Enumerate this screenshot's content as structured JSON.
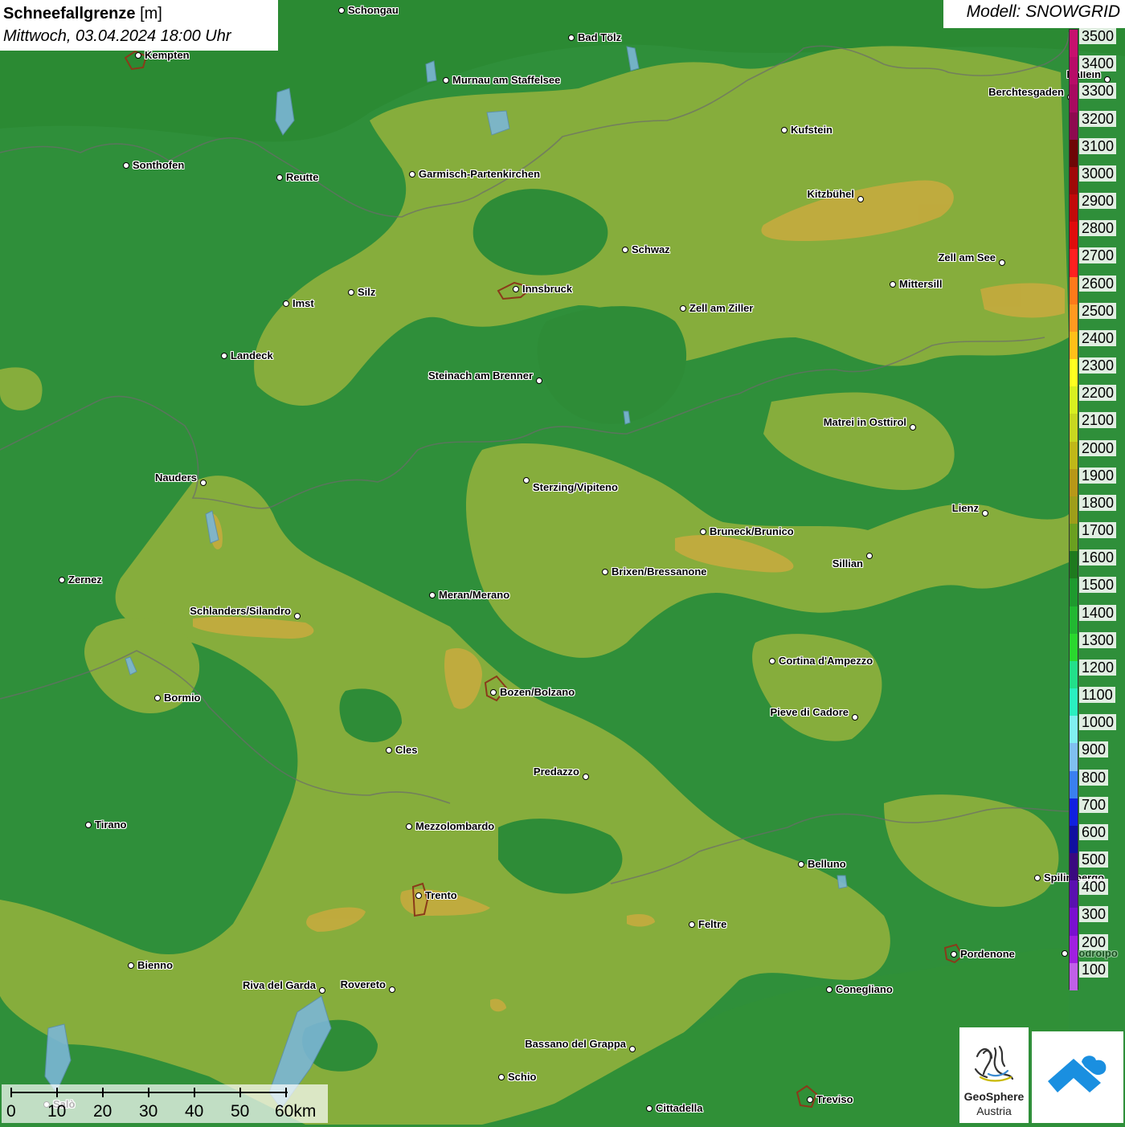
{
  "title": {
    "main": "Schneefallgrenze",
    "unit": "[m]",
    "datetime": "Mittwoch, 03.04.2024 18:00 Uhr"
  },
  "model": "Modell: SNOWGRID",
  "legend": {
    "stops": [
      {
        "label": "3500",
        "color": "#c7106e"
      },
      {
        "label": "3400",
        "color": "#b80c68"
      },
      {
        "label": "3300",
        "color": "#a80a60"
      },
      {
        "label": "3200",
        "color": "#8e0a50"
      },
      {
        "label": "3100",
        "color": "#6e0606"
      },
      {
        "label": "3000",
        "color": "#a00808"
      },
      {
        "label": "2900",
        "color": "#c20a0a"
      },
      {
        "label": "2800",
        "color": "#e00c0c"
      },
      {
        "label": "2700",
        "color": "#ff2020"
      },
      {
        "label": "2600",
        "color": "#ff7a1a"
      },
      {
        "label": "2500",
        "color": "#ff9a20"
      },
      {
        "label": "2400",
        "color": "#ffc018"
      },
      {
        "label": "2300",
        "color": "#ffff20"
      },
      {
        "label": "2200",
        "color": "#d8f020"
      },
      {
        "label": "2100",
        "color": "#c8d820"
      },
      {
        "label": "2000",
        "color": "#c0b818"
      },
      {
        "label": "1900",
        "color": "#b89818"
      },
      {
        "label": "1800",
        "color": "#9e9e1a"
      },
      {
        "label": "1700",
        "color": "#6aa020"
      },
      {
        "label": "1600",
        "color": "#1e7a1e"
      },
      {
        "label": "1500",
        "color": "#1e9a2e"
      },
      {
        "label": "1400",
        "color": "#22b832"
      },
      {
        "label": "1300",
        "color": "#2ad82e"
      },
      {
        "label": "1200",
        "color": "#22e08a"
      },
      {
        "label": "1100",
        "color": "#2af0c0"
      },
      {
        "label": "1000",
        "color": "#80f0f0"
      },
      {
        "label": "900",
        "color": "#80c0f0"
      },
      {
        "label": "800",
        "color": "#3a80f0"
      },
      {
        "label": "700",
        "color": "#1020e0"
      },
      {
        "label": "600",
        "color": "#1010a0"
      },
      {
        "label": "500",
        "color": "#3a0a80"
      },
      {
        "label": "400",
        "color": "#5a10b0"
      },
      {
        "label": "300",
        "color": "#7a10d0"
      },
      {
        "label": "200",
        "color": "#a020e0"
      },
      {
        "label": "100",
        "color": "#c060e8"
      }
    ]
  },
  "scale": {
    "labels": [
      "0",
      "10",
      "20",
      "30",
      "40",
      "50",
      "60km"
    ]
  },
  "logos": {
    "geosphere_line1": "GeoSphere",
    "geosphere_line2": "Austria"
  },
  "cities": [
    {
      "name": "Schongau"
    },
    {
      "name": "Bad Tölz"
    },
    {
      "name": "Kempten"
    },
    {
      "name": "Murnau am Staffelsee"
    },
    {
      "name": "Hallein"
    },
    {
      "name": "Berchtesgaden"
    },
    {
      "name": "Kufstein"
    },
    {
      "name": "Sonthofen"
    },
    {
      "name": "Reutte"
    },
    {
      "name": "Garmisch-Partenkirchen"
    },
    {
      "name": "Kitzbühel"
    },
    {
      "name": "Schwaz"
    },
    {
      "name": "Zell am See"
    },
    {
      "name": "Mittersill"
    },
    {
      "name": "Innsbruck"
    },
    {
      "name": "Imst"
    },
    {
      "name": "Silz"
    },
    {
      "name": "Zell am Ziller"
    },
    {
      "name": "Landeck"
    },
    {
      "name": "Steinach am Brenner"
    },
    {
      "name": "Matrei in Osttirol"
    },
    {
      "name": "Nauders"
    },
    {
      "name": "Sterzing/Vipiteno"
    },
    {
      "name": "Lienz"
    },
    {
      "name": "Bruneck/Brunico"
    },
    {
      "name": "Sillian"
    },
    {
      "name": "Brixen/Bressanone"
    },
    {
      "name": "Zernez"
    },
    {
      "name": "Meran/Merano"
    },
    {
      "name": "Schlanders/Silandro"
    },
    {
      "name": "Cortina d'Ampezzo"
    },
    {
      "name": "Bozen/Bolzano"
    },
    {
      "name": "Bormio"
    },
    {
      "name": "Pieve di Cadore"
    },
    {
      "name": "Cles"
    },
    {
      "name": "Predazzo"
    },
    {
      "name": "Tirano"
    },
    {
      "name": "Mezzolombardo"
    },
    {
      "name": "Belluno"
    },
    {
      "name": "Spilimbergo"
    },
    {
      "name": "Trento"
    },
    {
      "name": "Feltre"
    },
    {
      "name": "Pordenone"
    },
    {
      "name": "Codroipo"
    },
    {
      "name": "Bienno"
    },
    {
      "name": "Riva del Garda"
    },
    {
      "name": "Rovereto"
    },
    {
      "name": "Conegliano"
    },
    {
      "name": "Bassano del Grappa"
    },
    {
      "name": "Schio"
    },
    {
      "name": "Treviso"
    },
    {
      "name": "Cittadella"
    },
    {
      "name": "Salò"
    }
  ]
}
